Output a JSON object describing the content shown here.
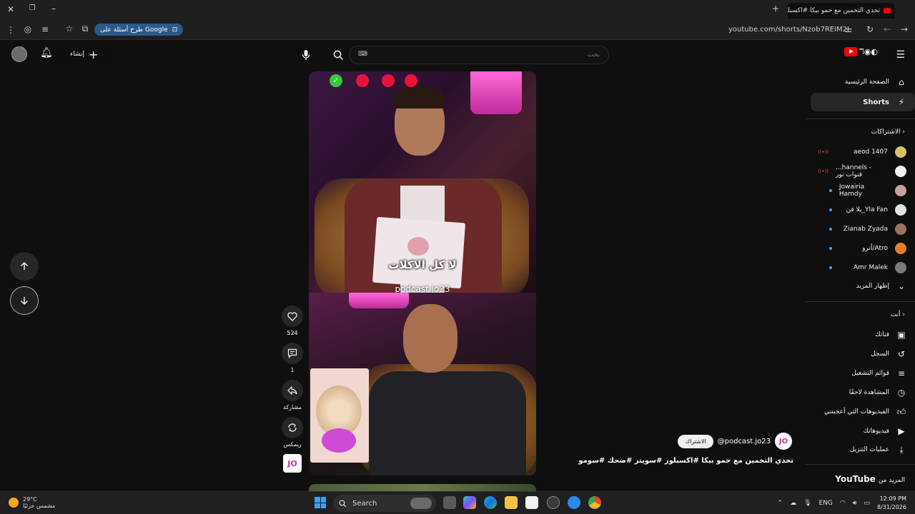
{
  "browser": {
    "tab_title": "تحدي التخمين مع حمو بيكا #اكسبلور",
    "url": "youtube.com/shorts/Nzob7REIM2I",
    "google_chip": "طرح أسئلة على Google"
  },
  "header": {
    "search_placeholder": "بحث",
    "create_label": "إنشاء"
  },
  "video": {
    "caption_ar": "لا كل الاكلات",
    "caption_handle": "podcast.jo23",
    "title": "تحدي التخمين مع حمو بيكا #اكسبلور #سويتز #ضحك #سومو",
    "channel": "@podcast.jo23",
    "subscribe": "الاشتراك",
    "channel_thumb": "JO"
  },
  "actions": {
    "likes": "524",
    "comments": "1",
    "share": "مشاركة",
    "remix": "ريمكس"
  },
  "sidebar": {
    "home": "الصفحة الرئيسية",
    "shorts": "Shorts",
    "subscriptions_header": "الاشتراكات",
    "channels": [
      {
        "name": "aeod 1407",
        "badge": "live"
      },
      {
        "name": "...hannels - قنوات نور",
        "badge": "live"
      },
      {
        "name": "Jowairia Hamdy",
        "badge": "dot"
      },
      {
        "name": "يلا فن_Yla Fan",
        "badge": "dot"
      },
      {
        "name": "Zianab Zyada",
        "badge": "dot"
      },
      {
        "name": "أترو/Atro",
        "badge": "dot"
      },
      {
        "name": "Amr Malek",
        "badge": "dot"
      }
    ],
    "show_more": "إظهار المزيد",
    "you_header": "أنت",
    "you_items": [
      "قناتك",
      "السجل",
      "قوائم التشغيل",
      "المشاهدة لاحقًا",
      "الفيديوهات التي أعجبتني",
      "فيديوهاتك",
      "عمليات التنزيل"
    ],
    "more_from": "المزيد من",
    "more_from_brand": "YouTube"
  },
  "taskbar": {
    "temp": "29°C",
    "weather": "مشمس جزئيًا",
    "search": "Search",
    "lang": "ENG",
    "time": "12:09 PM",
    "date": "8/31/2026"
  }
}
